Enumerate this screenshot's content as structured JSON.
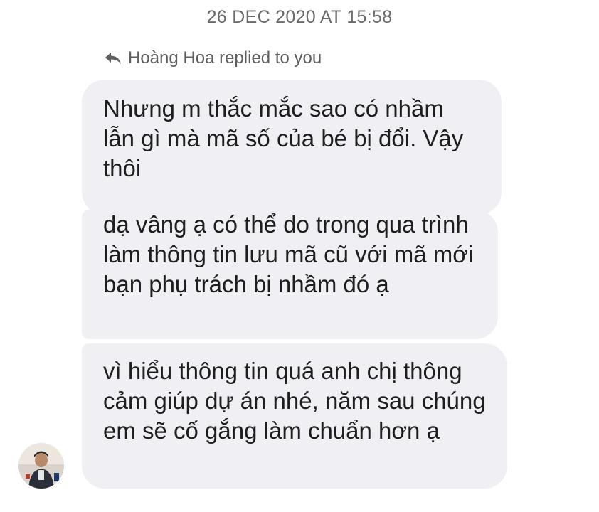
{
  "timestamp": "26 DEC 2020 AT 15:58",
  "reply": {
    "icon": "reply-arrow-icon",
    "text": "Hoàng Hoa replied to you"
  },
  "messages": [
    "Nhưng m thắc mắc sao có nhầm lẫn gì mà mã số của bé bị đổi. Vậy thôi",
    "dạ vâng ạ có thể do trong qua trình làm thông tin lưu mã cũ với mã mới bạn phụ trách bị nhầm đó ạ",
    "vì hiểu thông tin quá anh chị thông cảm giúp dự án nhé, năm sau chúng em sẽ cố gắng làm chuẩn hơn ạ"
  ],
  "colors": {
    "bubble": "#f0f0f4",
    "timestamp": "#6b6b6b",
    "reply_text": "#5e5e5e"
  }
}
